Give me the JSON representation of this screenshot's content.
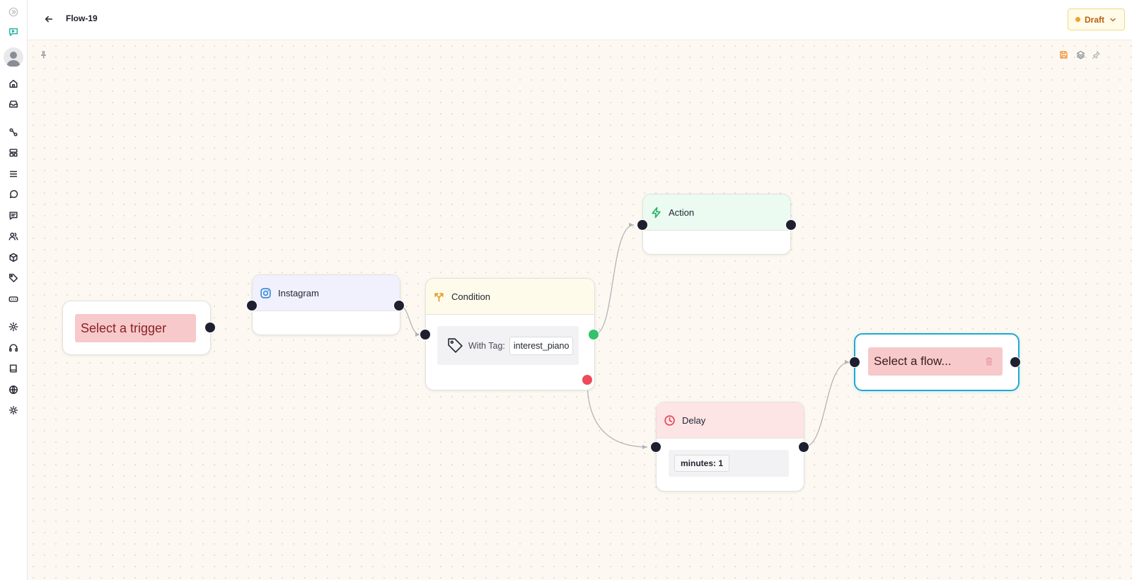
{
  "header": {
    "flow_title": "Flow-19",
    "status_label": "Draft"
  },
  "sidebar": {
    "top_icons": [
      "collapse-icon",
      "bot-chat-icon"
    ],
    "nav_icons": [
      "home-icon",
      "inbox-icon",
      "flows-icon",
      "templates-icon",
      "list-icon",
      "chat-icon",
      "messages-icon",
      "contacts-icon",
      "products-icon",
      "tags-icon",
      "integrations-icon"
    ],
    "bottom_icons": [
      "settings-icon",
      "support-icon",
      "docs-icon",
      "language-icon",
      "theme-icon"
    ]
  },
  "canvas": {
    "toolbar_icons": [
      "save-icon",
      "layers-icon",
      "pin-icon"
    ]
  },
  "nodes": {
    "trigger": {
      "label": "Select a trigger"
    },
    "instagram": {
      "title": "Instagram"
    },
    "condition": {
      "title": "Condition",
      "tag_label": "With Tag:",
      "tag_value": "interest_piano"
    },
    "action": {
      "title": "Action"
    },
    "delay": {
      "title": "Delay",
      "value": "minutes: 1"
    },
    "flow": {
      "label": "Select a flow..."
    }
  },
  "colors": {
    "canvas_bg": "#fdf9f2",
    "draft_text": "#b85e10",
    "true_handle": "#34c26a",
    "false_handle": "#ef4a5a",
    "selected_border": "#1fa9d4",
    "trigger_pill": "#f7c9ca"
  }
}
